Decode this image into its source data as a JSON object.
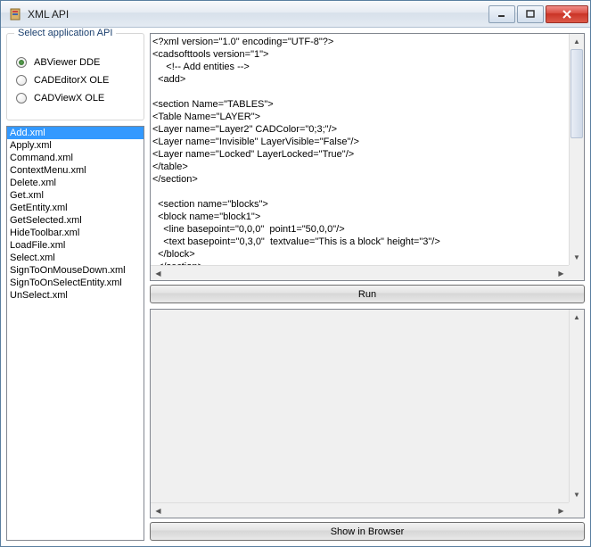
{
  "window": {
    "title": "XML API"
  },
  "groupbox": {
    "title": "Select application API",
    "options": [
      {
        "label": "ABViewer DDE",
        "checked": true
      },
      {
        "label": "CADEditorX OLE",
        "checked": false
      },
      {
        "label": "CADViewX OLE",
        "checked": false
      }
    ]
  },
  "files": [
    "Add.xml",
    "Apply.xml",
    "Command.xml",
    "ContextMenu.xml",
    "Delete.xml",
    "Get.xml",
    "GetEntity.xml",
    "GetSelected.xml",
    "HideToolbar.xml",
    "LoadFile.xml",
    "Select.xml",
    "SignToOnMouseDown.xml",
    "SignToOnSelectEntity.xml",
    "UnSelect.xml"
  ],
  "selected_file_index": 0,
  "code_text": "<?xml version=\"1.0\" encoding=\"UTF-8\"?>\n<cadsofttools version=\"1\">\n     <!-- Add entities -->\n  <add>\n\n<section Name=\"TABLES\">\n<Table Name=\"LAYER\">\n<Layer name=\"Layer2\" CADColor=\"0;3;\"/>\n<Layer name=\"Invisible\" LayerVisible=\"False\"/>\n<Layer name=\"Locked\" LayerLocked=\"True\"/>\n</table>\n</section>\n\n  <section name=\"blocks\">\n  <block name=\"block1\">\n    <line basepoint=\"0,0,0\"  point1=\"50,0,0\"/>\n    <text basepoint=\"0,3,0\"  textvalue=\"This is a block\" height=\"3\"/>\n  </block>\n  </section>",
  "output_text": "",
  "buttons": {
    "run": "Run",
    "show_in_browser": "Show in Browser"
  }
}
